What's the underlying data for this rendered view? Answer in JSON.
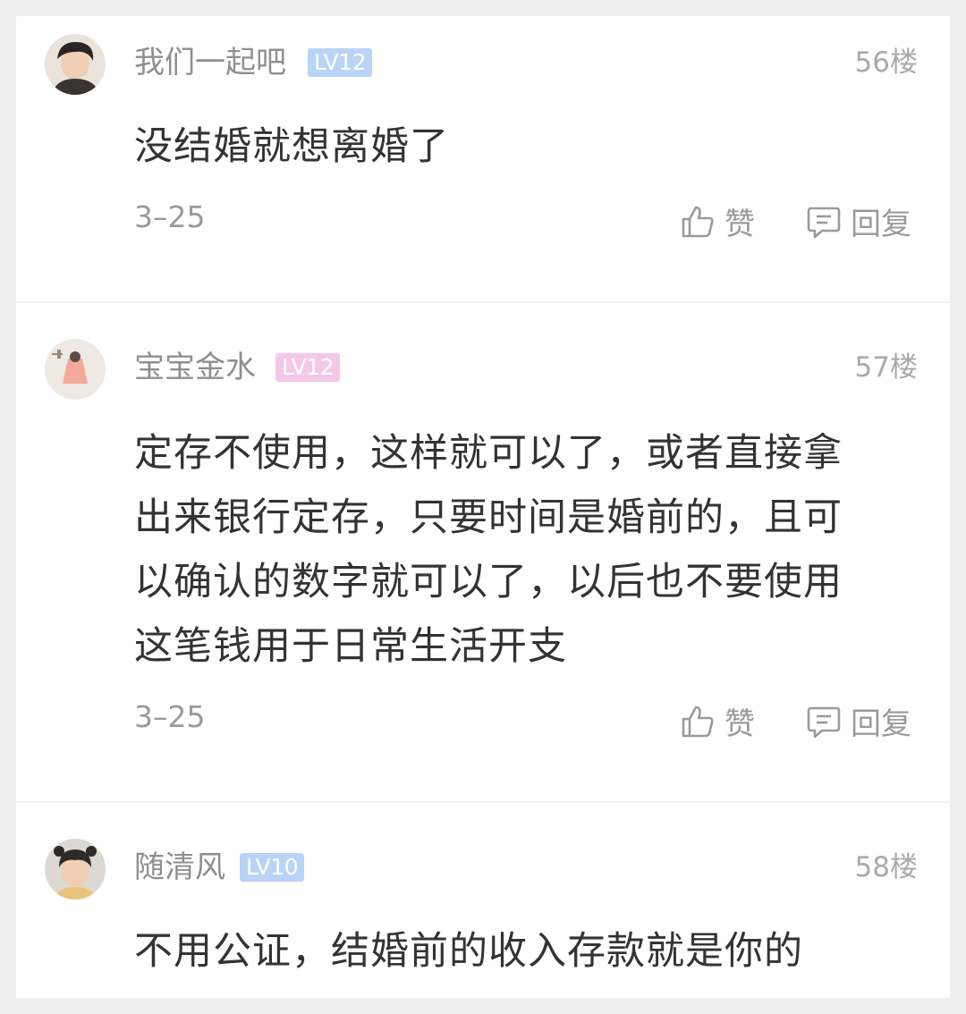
{
  "comments": [
    {
      "username": "我们一起吧",
      "level": "LV12",
      "level_color": "#b9d4f7",
      "floor": "56楼",
      "text": "没结婚就想离婚了",
      "date": "3–25",
      "like_label": "赞",
      "reply_label": "回复"
    },
    {
      "username": "宝宝金水",
      "level": "LV12",
      "level_color": "#f5c8e9",
      "floor": "57楼",
      "text_lines": [
        "定存不使用，这样就可以了，或者直接拿",
        "出来银行定存，只要时间是婚前的，且可",
        "以确认的数字就可以了，以后也不要使用",
        "这笔钱用于日常生活开支"
      ],
      "date": "3–25",
      "like_label": "赞",
      "reply_label": "回复"
    },
    {
      "username": "随清风",
      "level": "LV10",
      "level_color": "#b9d4f7",
      "floor": "58楼",
      "text": "不用公证，结婚前的收入存款就是你的"
    }
  ],
  "icons": {
    "like": "thumbs-up-icon",
    "reply": "comment-icon"
  }
}
